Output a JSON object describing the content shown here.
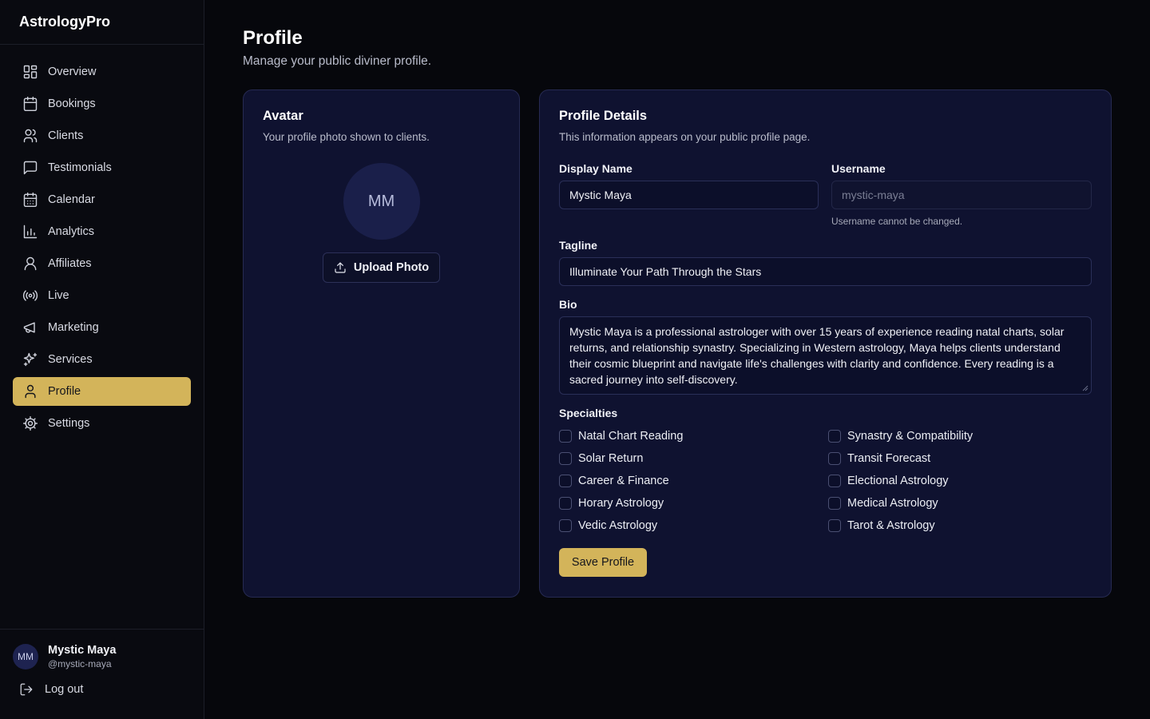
{
  "app": {
    "brand": "AstrologyPro"
  },
  "sidebar": {
    "items": [
      {
        "label": "Overview",
        "icon": "grid-icon"
      },
      {
        "label": "Bookings",
        "icon": "calendar-icon"
      },
      {
        "label": "Clients",
        "icon": "users-icon"
      },
      {
        "label": "Testimonials",
        "icon": "message-square-icon"
      },
      {
        "label": "Calendar",
        "icon": "calendar-days-icon"
      },
      {
        "label": "Analytics",
        "icon": "bar-chart-icon"
      },
      {
        "label": "Affiliates",
        "icon": "user-round-icon"
      },
      {
        "label": "Live",
        "icon": "radio-icon"
      },
      {
        "label": "Marketing",
        "icon": "megaphone-icon"
      },
      {
        "label": "Services",
        "icon": "sparkles-icon"
      },
      {
        "label": "Profile",
        "icon": "user-icon",
        "active": true
      },
      {
        "label": "Settings",
        "icon": "settings-icon"
      }
    ],
    "user": {
      "initials": "MM",
      "name": "Mystic Maya",
      "handle": "@mystic-maya"
    },
    "logout_label": "Log out"
  },
  "page": {
    "title": "Profile",
    "subtitle": "Manage your public diviner profile."
  },
  "avatar_card": {
    "title": "Avatar",
    "description": "Your profile photo shown to clients.",
    "initials": "MM",
    "upload_label": "Upload Photo"
  },
  "details_card": {
    "title": "Profile Details",
    "description": "This information appears on your public profile page.",
    "display_name": {
      "label": "Display Name",
      "value": "Mystic Maya"
    },
    "username": {
      "label": "Username",
      "value": "mystic-maya",
      "hint": "Username cannot be changed."
    },
    "tagline": {
      "label": "Tagline",
      "value": "Illuminate Your Path Through the Stars"
    },
    "bio": {
      "label": "Bio",
      "value": "Mystic Maya is a professional astrologer with over 15 years of experience reading natal charts, solar returns, and relationship synastry. Specializing in Western astrology, Maya helps clients understand their cosmic blueprint and navigate life's challenges with clarity and confidence. Every reading is a sacred journey into self-discovery."
    },
    "specialties_label": "Specialties",
    "specialties": [
      {
        "label": "Natal Chart Reading",
        "checked": false
      },
      {
        "label": "Synastry & Compatibility",
        "checked": false
      },
      {
        "label": "Solar Return",
        "checked": false
      },
      {
        "label": "Transit Forecast",
        "checked": false
      },
      {
        "label": "Career & Finance",
        "checked": false
      },
      {
        "label": "Electional Astrology",
        "checked": false
      },
      {
        "label": "Horary Astrology",
        "checked": false
      },
      {
        "label": "Medical Astrology",
        "checked": false
      },
      {
        "label": "Vedic Astrology",
        "checked": false
      },
      {
        "label": "Tarot & Astrology",
        "checked": false
      }
    ],
    "save_label": "Save Profile"
  },
  "colors": {
    "accent": "#d3b45a",
    "card": "#0f1230",
    "background": "#06070c"
  }
}
